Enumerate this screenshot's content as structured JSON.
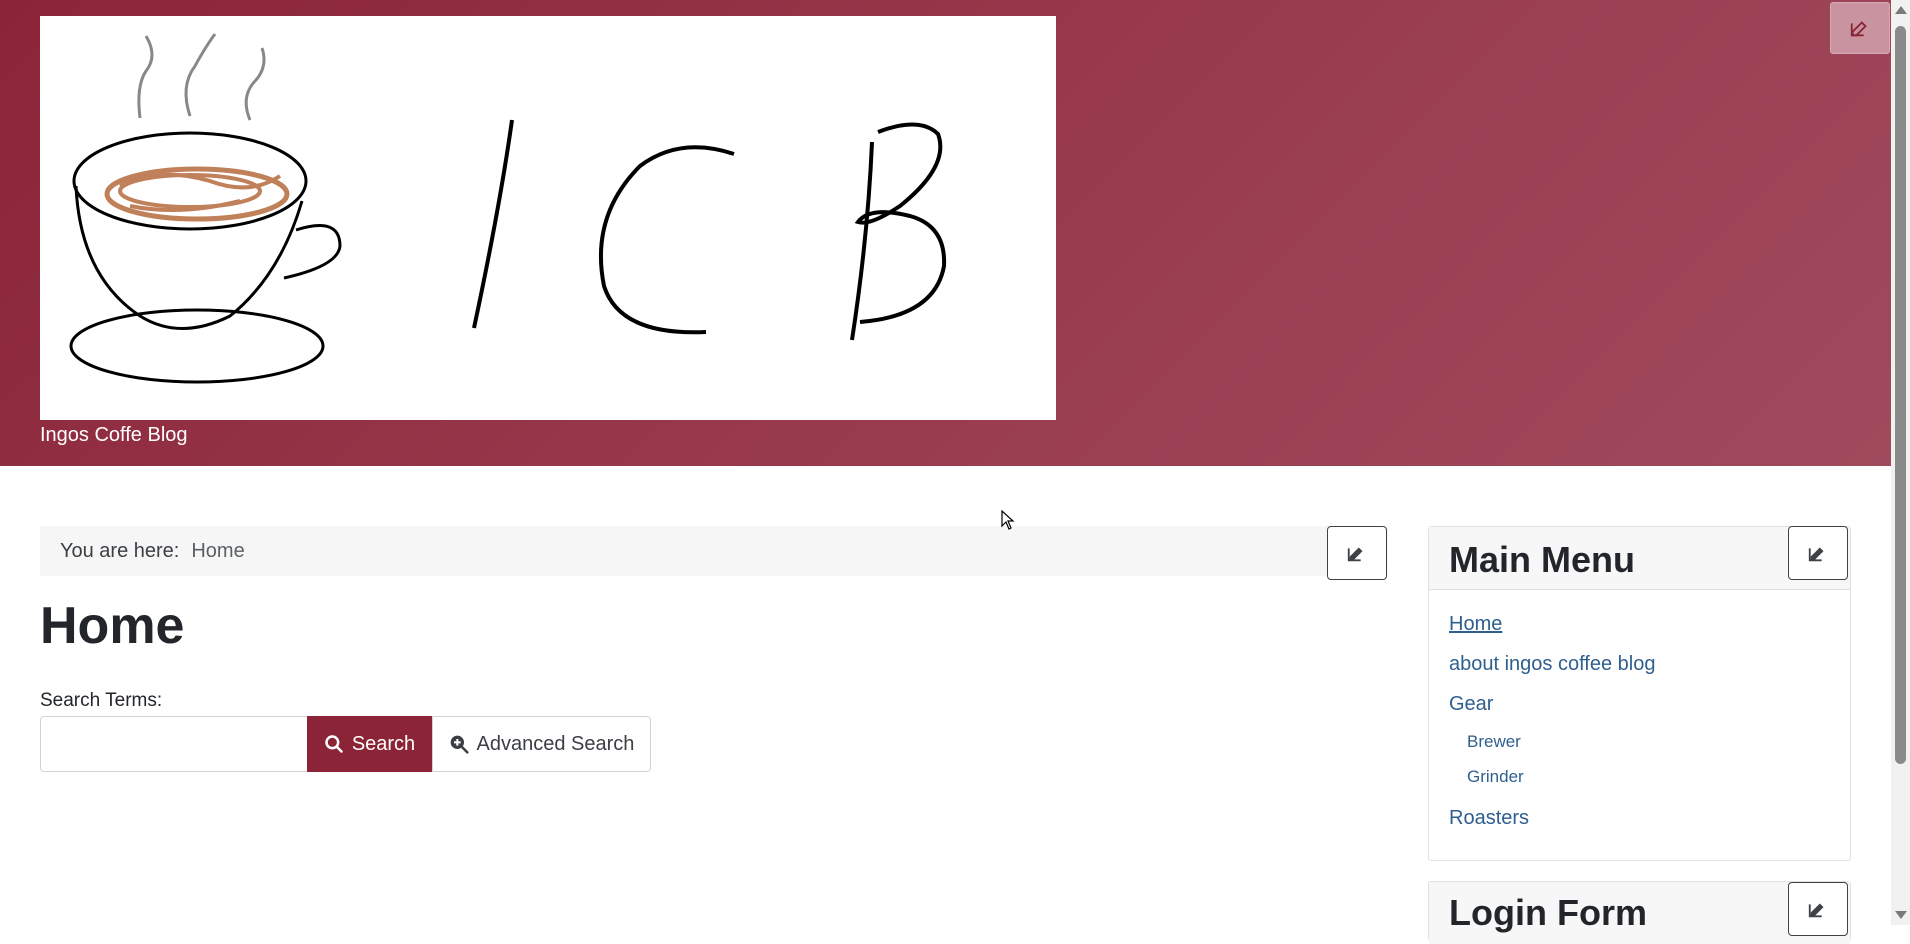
{
  "header": {
    "site_title": "Ingos Coffe Blog",
    "logo_text": "ICB",
    "background_color": "#8b2437"
  },
  "breadcrumb": {
    "label": "You are here:",
    "current": "Home"
  },
  "page": {
    "title": "Home"
  },
  "search": {
    "label": "Search Terms:",
    "value": "",
    "placeholder": "",
    "search_button": "Search",
    "advanced_button": "Advanced Search"
  },
  "sidebar": {
    "main_menu": {
      "title": "Main Menu",
      "items": [
        {
          "label": "Home",
          "active": true
        },
        {
          "label": "about ingos coffee blog"
        },
        {
          "label": "Gear"
        },
        {
          "label": "Roasters"
        }
      ],
      "gear_children": [
        {
          "label": "Brewer"
        },
        {
          "label": "Grinder"
        }
      ]
    },
    "login_form": {
      "title": "Login Form"
    }
  },
  "icons": {
    "edit": "edit-icon",
    "search": "search-icon",
    "advanced_search": "search-plus-icon"
  },
  "colors": {
    "accent": "#8b2437",
    "link": "#2f5f8f"
  }
}
